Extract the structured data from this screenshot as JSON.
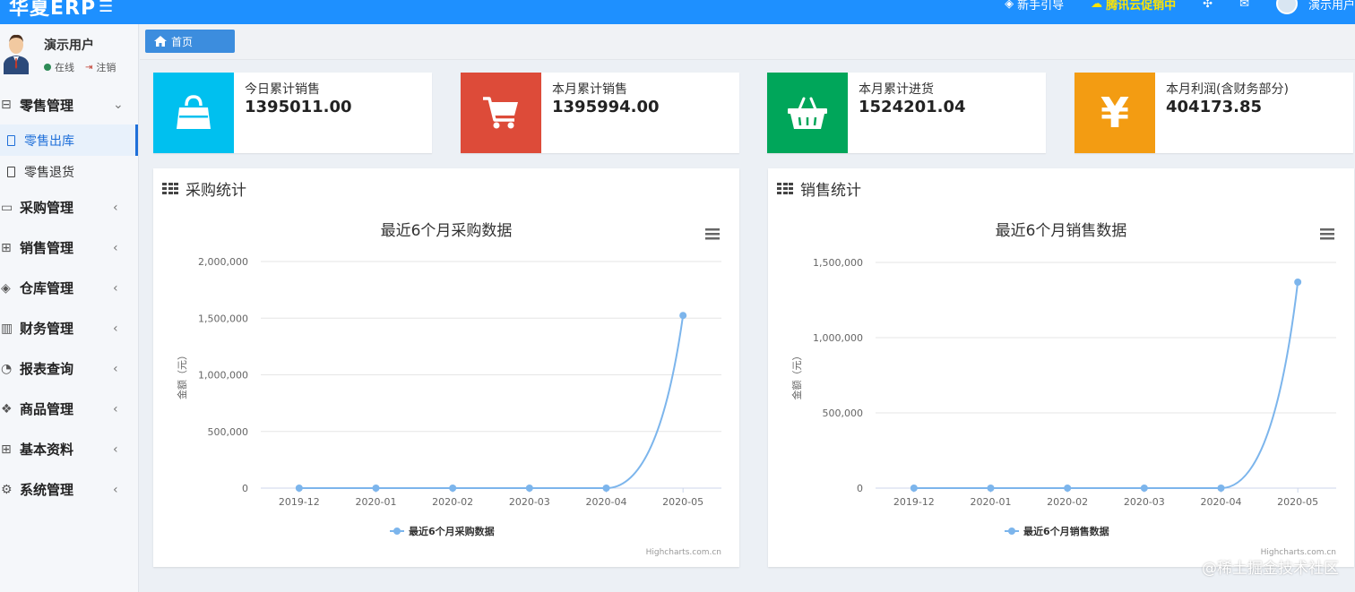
{
  "header": {
    "logo": "华夏ERP",
    "guide": "新手引导",
    "promo": "腾讯云促销中",
    "user": "演示用户"
  },
  "sidebar": {
    "user_name": "演示用户",
    "status_online": "在线",
    "logout": "注销",
    "groups": [
      {
        "label": "零售管理",
        "icon": "gift-icon",
        "expanded": true,
        "items": [
          {
            "label": "零售出库",
            "active": true
          },
          {
            "label": "零售退货",
            "active": false
          }
        ]
      },
      {
        "label": "采购管理",
        "icon": "laptop-icon"
      },
      {
        "label": "销售管理",
        "icon": "briefcase-icon"
      },
      {
        "label": "仓库管理",
        "icon": "layers-icon"
      },
      {
        "label": "财务管理",
        "icon": "map-icon"
      },
      {
        "label": "报表查询",
        "icon": "pie-chart-icon"
      },
      {
        "label": "商品管理",
        "icon": "cubes-icon"
      },
      {
        "label": "基本资料",
        "icon": "grid-icon"
      },
      {
        "label": "系统管理",
        "icon": "gear-icon"
      }
    ]
  },
  "breadcrumb": {
    "home": "首页"
  },
  "stats": [
    {
      "label": "今日累计销售",
      "value": "1395011.00",
      "color": "#00c0ef",
      "icon": "shopping-bag-icon"
    },
    {
      "label": "本月累计销售",
      "value": "1395994.00",
      "color": "#dd4b39",
      "icon": "shopping-cart-icon"
    },
    {
      "label": "本月累计进货",
      "value": "1524201.04",
      "color": "#00a65a",
      "icon": "basket-icon"
    },
    {
      "label": "本月利润(含财务部分)",
      "value": "404173.85",
      "color": "#f39c12",
      "icon": "yen-icon"
    }
  ],
  "panels": {
    "purchase_title": "采购统计",
    "sales_title": "销售统计"
  },
  "chart_data": [
    {
      "type": "line",
      "title": "最近6个月采购数据",
      "ylabel": "金额（元）",
      "x": [
        "2019-12",
        "2020-01",
        "2020-02",
        "2020-03",
        "2020-04",
        "2020-05"
      ],
      "yticks": [
        "0",
        "500,000",
        "1,000,000",
        "1,500,000",
        "2,000,000"
      ],
      "ylim": [
        0,
        2000000
      ],
      "series": [
        {
          "name": "最近6个月采购数据",
          "values": [
            0,
            0,
            0,
            0,
            0,
            1524201
          ]
        }
      ],
      "legend": "bottom-center",
      "credits": "Highcharts.com.cn",
      "color": "#7cb5ec"
    },
    {
      "type": "line",
      "title": "最近6个月销售数据",
      "ylabel": "金额（元）",
      "x": [
        "2019-12",
        "2020-01",
        "2020-02",
        "2020-03",
        "2020-04",
        "2020-05"
      ],
      "yticks": [
        "0",
        "500,000",
        "1,000,000",
        "1,500,000"
      ],
      "ylim": [
        0,
        1500000
      ],
      "series": [
        {
          "name": "最近6个月销售数据",
          "values": [
            0,
            0,
            0,
            0,
            0,
            1369000
          ]
        }
      ],
      "legend": "bottom-center",
      "credits": "Highcharts.com.cn",
      "color": "#7cb5ec"
    }
  ],
  "watermark": "@稀土掘金技术社区"
}
